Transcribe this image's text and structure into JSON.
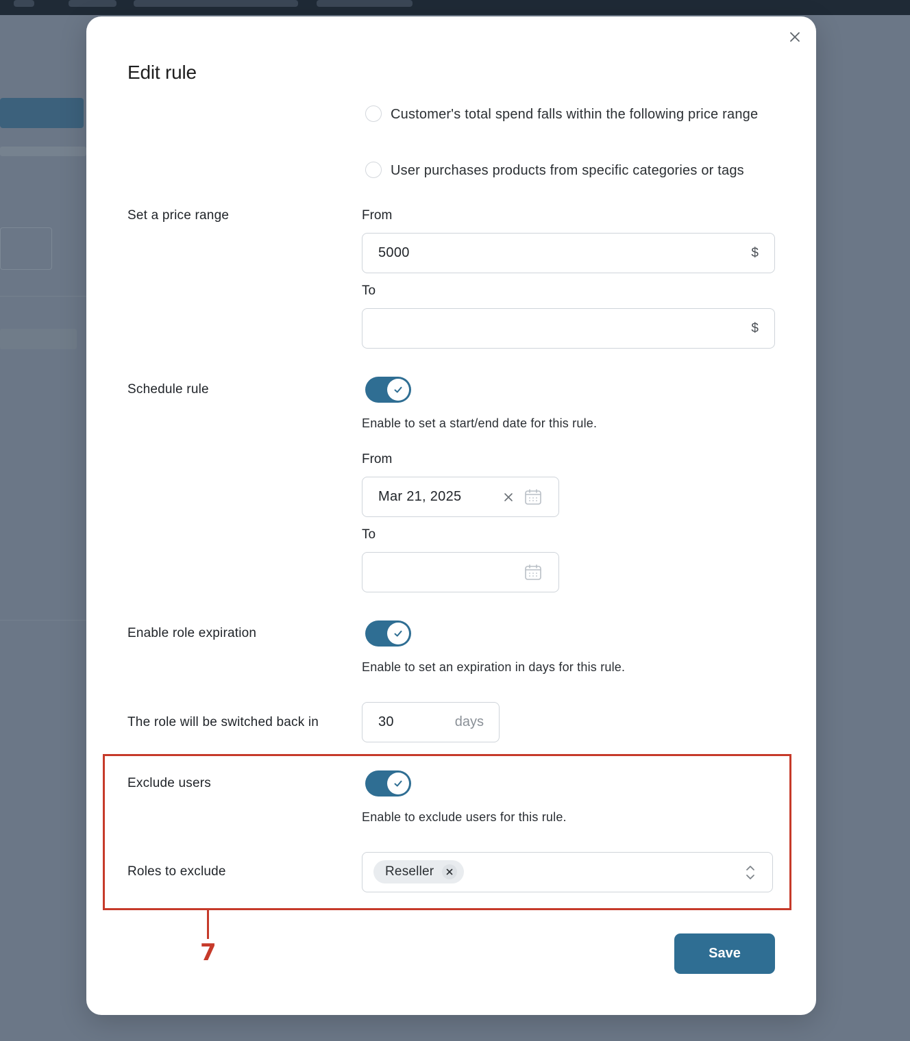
{
  "modal": {
    "title": "Edit rule"
  },
  "conditions": {
    "options": [
      {
        "label": "Customer's total spend falls within the following price range"
      },
      {
        "label": "User purchases products from specific categories or tags"
      }
    ]
  },
  "price_range": {
    "label": "Set a price range",
    "from_label": "From",
    "from_value": "5000",
    "to_label": "To",
    "to_value": "",
    "currency": "$"
  },
  "schedule": {
    "label": "Schedule rule",
    "enabled": true,
    "help": "Enable to set a start/end date for this rule.",
    "from_label": "From",
    "from_value": "Mar 21, 2025",
    "to_label": "To",
    "to_value": ""
  },
  "expiration": {
    "label": "Enable role expiration",
    "enabled": true,
    "help": "Enable to set an expiration in days for this rule.",
    "switch_back_label": "The role will be switched back in",
    "days_value": "30",
    "days_unit": "days"
  },
  "exclude": {
    "label": "Exclude users",
    "enabled": true,
    "help": "Enable to exclude users for this rule.",
    "roles_label": "Roles to exclude",
    "roles": [
      "Reseller"
    ]
  },
  "actions": {
    "save_label": "Save"
  },
  "annotation": {
    "number": "7",
    "color": "#c63a2a"
  },
  "colors": {
    "accent": "#2f6e93"
  }
}
